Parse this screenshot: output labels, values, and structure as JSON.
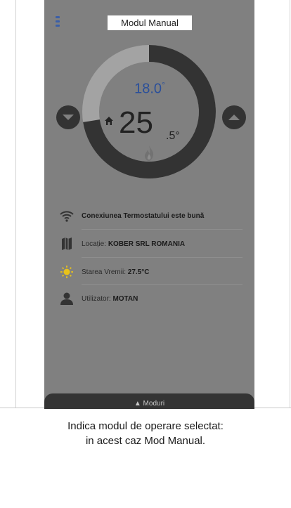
{
  "header": {
    "title": "Modul Manual"
  },
  "thermostat": {
    "setpoint_main": "18.0",
    "setpoint_degree": "°",
    "current_main": "25",
    "current_decimal": ".5°"
  },
  "info": {
    "connection": "Conexiunea Termostatului este bună",
    "location_label": "Locație: ",
    "location_value": "KOBER SRL ROMANIA",
    "weather_label": "Starea Vremii: ",
    "weather_value": "27.5°C",
    "user_label": "Utilizator: ",
    "user_value": "MOTAN"
  },
  "bottom_bar": {
    "label": "▲ Moduri"
  },
  "caption": {
    "line1": "Indica modul de operare selectat:",
    "line2": "in acest caz Mod Manual."
  },
  "colors": {
    "accent_blue": "#2a4f9a",
    "dial_dark": "#333333",
    "dial_light": "#a3a3a3",
    "overlay_gray": "#808080",
    "sun": "#e8c21a"
  },
  "icons": [
    "menu-icon",
    "home-icon",
    "flame-icon",
    "chevron-down-icon",
    "chevron-up-icon",
    "wifi-icon",
    "map-icon",
    "sun-icon",
    "user-icon"
  ]
}
